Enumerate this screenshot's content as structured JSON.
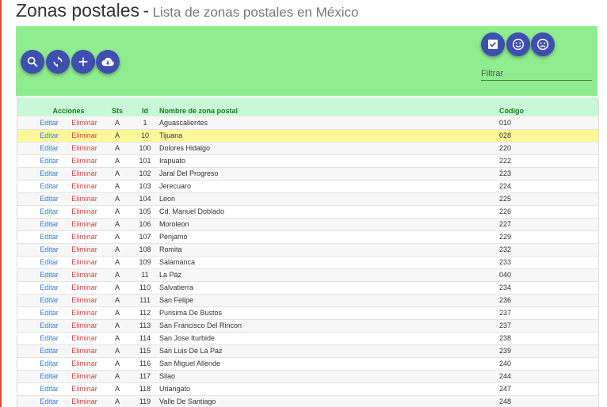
{
  "header": {
    "title": "Zonas postales",
    "separator": "-",
    "subtitle": "Lista de zonas postales en México"
  },
  "toolbar": {
    "buttons": [
      "search-icon",
      "refresh-icon",
      "add-icon",
      "cloud-download-icon"
    ],
    "status_buttons": [
      "check-box-icon",
      "smile-icon",
      "sad-face-icon"
    ],
    "filter_placeholder": "Filtrar",
    "background": "#8fed8f",
    "button_color": "#3f4fb0"
  },
  "table": {
    "headers": {
      "acciones": "Acciones",
      "sts": "Sts",
      "id": "Id",
      "nombre": "Nombre de zona postal",
      "codigo": "Código"
    },
    "edit_label": "Editar",
    "delete_label": "Eliminar",
    "header_bg": "#c8f8d8",
    "selected_bg": "#fcf89a",
    "rows": [
      {
        "sts": "A",
        "id": "1",
        "nombre": "Aguascalientes",
        "codigo": "010"
      },
      {
        "sts": "A",
        "id": "10",
        "nombre": "Tijuana",
        "codigo": "028",
        "selected": true
      },
      {
        "sts": "A",
        "id": "100",
        "nombre": "Dolores Hidalgo",
        "codigo": "220"
      },
      {
        "sts": "A",
        "id": "101",
        "nombre": "Irapuato",
        "codigo": "222"
      },
      {
        "sts": "A",
        "id": "102",
        "nombre": "Jaral Del Progreso",
        "codigo": "223"
      },
      {
        "sts": "A",
        "id": "103",
        "nombre": "Jerecuaro",
        "codigo": "224"
      },
      {
        "sts": "A",
        "id": "104",
        "nombre": "Leon",
        "codigo": "225"
      },
      {
        "sts": "A",
        "id": "105",
        "nombre": "Cd. Manuel Doblado",
        "codigo": "226"
      },
      {
        "sts": "A",
        "id": "106",
        "nombre": "Moroleon",
        "codigo": "227"
      },
      {
        "sts": "A",
        "id": "107",
        "nombre": "Penjamo",
        "codigo": "229"
      },
      {
        "sts": "A",
        "id": "108",
        "nombre": "Romita",
        "codigo": "232"
      },
      {
        "sts": "A",
        "id": "109",
        "nombre": "Salamanca",
        "codigo": "233"
      },
      {
        "sts": "A",
        "id": "11",
        "nombre": "La Paz",
        "codigo": "040"
      },
      {
        "sts": "A",
        "id": "110",
        "nombre": "Salvatierra",
        "codigo": "234"
      },
      {
        "sts": "A",
        "id": "111",
        "nombre": "San Felipe",
        "codigo": "236"
      },
      {
        "sts": "A",
        "id": "112",
        "nombre": "Purisima De Bustos",
        "codigo": "237"
      },
      {
        "sts": "A",
        "id": "113",
        "nombre": "San Francisco Del Rincon",
        "codigo": "237"
      },
      {
        "sts": "A",
        "id": "114",
        "nombre": "San Jose Iturbide",
        "codigo": "238"
      },
      {
        "sts": "A",
        "id": "115",
        "nombre": "San Luis De La Paz",
        "codigo": "239"
      },
      {
        "sts": "A",
        "id": "116",
        "nombre": "San Miguel Allende",
        "codigo": "240"
      },
      {
        "sts": "A",
        "id": "117",
        "nombre": "Silao",
        "codigo": "244"
      },
      {
        "sts": "A",
        "id": "118",
        "nombre": "Uriangato",
        "codigo": "247"
      },
      {
        "sts": "A",
        "id": "119",
        "nombre": "Valle De Santiago",
        "codigo": "248"
      }
    ]
  }
}
